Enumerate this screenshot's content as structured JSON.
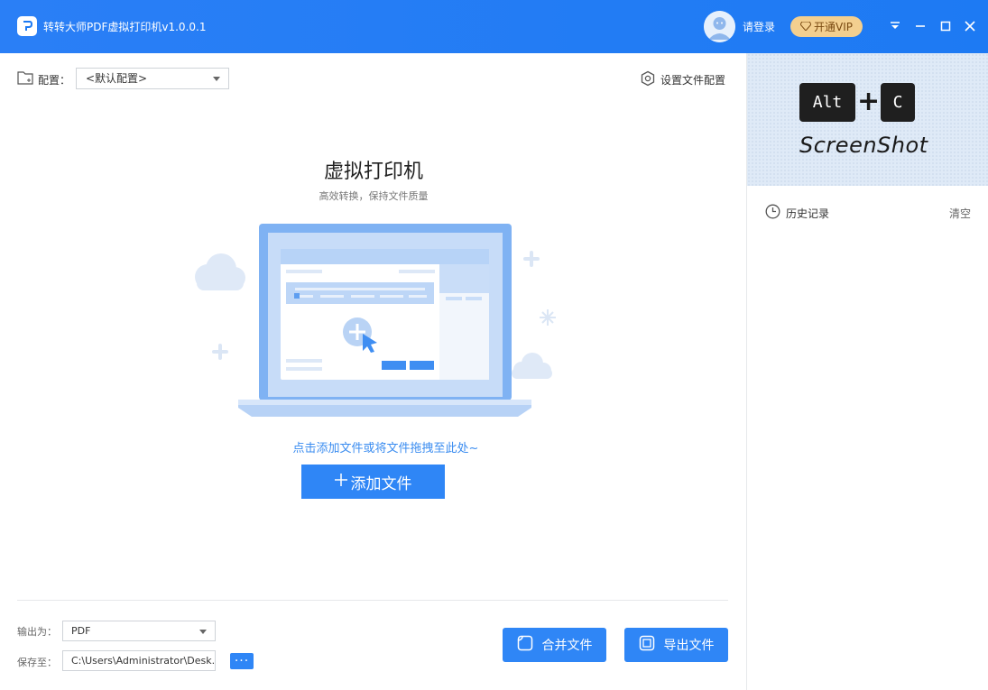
{
  "window": {
    "title": "转转大师PDF虚拟打印机v1.0.0.1",
    "login_label": "请登录",
    "vip_label": "开通VIP"
  },
  "config": {
    "label": "配置：",
    "selected": "<默认配置>",
    "settings_label": "设置文件配置"
  },
  "hero": {
    "title": "虚拟打印机",
    "subtitle": "高效转换，保持文件质量",
    "hint": "点击添加文件或将文件拖拽至此处~",
    "add_button_label": "添加文件"
  },
  "output": {
    "format_label": "输出为：",
    "format_value": "PDF",
    "save_label": "保存至：",
    "save_path": "C:\\Users\\Administrator\\Desk...",
    "browse_label": "···"
  },
  "actions": {
    "merge_label": "合并文件",
    "export_label": "导出文件"
  },
  "sidebar": {
    "promo_key_1": "Alt",
    "promo_key_2": "C",
    "promo_plus": "+",
    "promo_text": "ScreenShot",
    "history_label": "历史记录",
    "clear_label": "清空"
  },
  "colors": {
    "accent": "#2f86f6",
    "titlebar": "#1d7af3",
    "vip": "#f3cf8f"
  }
}
